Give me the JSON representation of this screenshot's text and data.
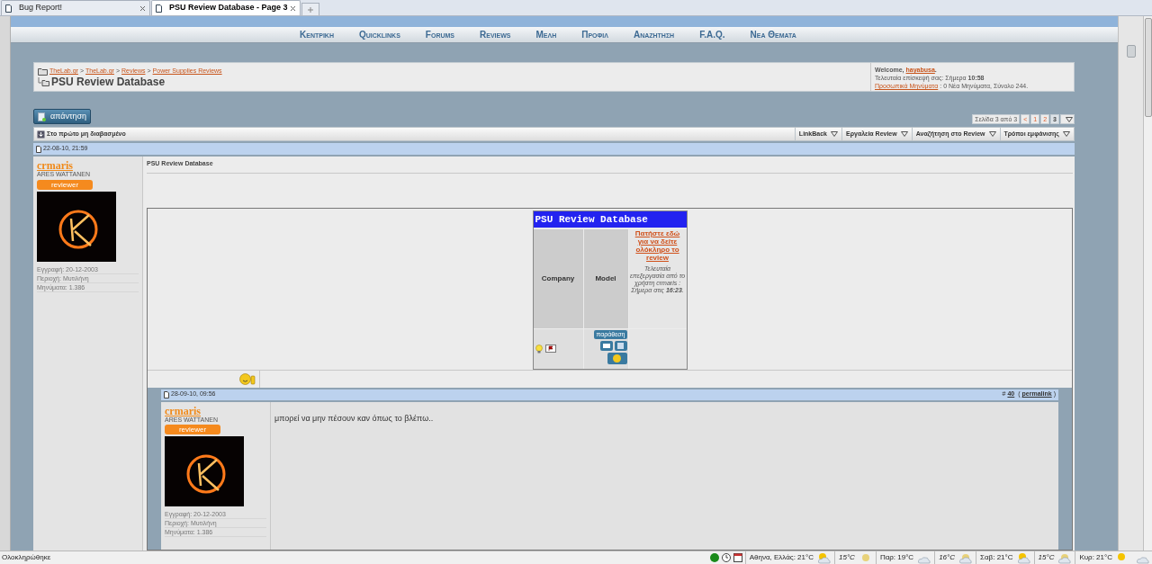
{
  "browser_tabs": [
    {
      "label": "Bug Report!",
      "selected": false
    },
    {
      "label": "PSU Review Database - Page 3",
      "selected": true
    }
  ],
  "nav": [
    "Κεντρικη",
    "Quicklinks",
    "Forums",
    "Reviews",
    "Μελη",
    "Προφιλ",
    "Αναζητηση",
    "F.A.Q.",
    "Νεα Θεματα"
  ],
  "breadcrumb": {
    "links": [
      "TheLab.gr",
      "TheLab.gr",
      "Reviews",
      "Power Supplies Reviews"
    ],
    "separator": ">",
    "title": "PSU Review Database"
  },
  "welcome": {
    "greeting": "Welcome,",
    "user": "hayabusa",
    "end": ".",
    "last_visit": "Τελευταία επίσκεψή σας: Σήμερα **10:58**",
    "pm_link": "Προσωπικά Μηνύματα",
    "pm_text": ": 0 Νέα Μηνύματα, Σύνολο 244."
  },
  "reply_button": "απάντηση",
  "pagination": {
    "label": "Σελίδα 3 από 3",
    "prev": "<",
    "pages": [
      {
        "label": "1",
        "selected": false
      },
      {
        "label": "2",
        "selected": false
      },
      {
        "label": "3",
        "selected": true
      }
    ]
  },
  "toolbar": {
    "first_unread": "Στο πρώτο μη διαβασμένο",
    "menus": [
      "LinkBack",
      "Εργαλεία Review",
      "Αναζήτηση στο Review",
      "Τρόποι εμφάνισης"
    ]
  },
  "posts": [
    {
      "date": "22-08-10, 21:59",
      "user": {
        "name": "crmaris",
        "title": "ARES WATTANEN",
        "rank": "reviewer",
        "stats": [
          "Εγγραφή: 20-12-2003",
          "Περιοχή: Μυτιλήνη",
          "Μηνύματα: 1.386"
        ]
      },
      "title": "PSU Review Database",
      "db_table": {
        "header": "PSU Review Database",
        "columns": [
          "Company",
          "Model"
        ],
        "link": "Πατήστε εδώ για να δείτε ολόκληρο το review",
        "edit_note": "Τελευταία επεξεργασία από το χρήστη crmaris : Σήμερα στις **16:23**.",
        "quote_button": "παράθεση"
      }
    },
    {
      "date": "28-09-10, 09:56",
      "number_prefix": "#",
      "number": "40",
      "permalink_open": "(",
      "permalink": "permalink",
      "permalink_close": ")",
      "user": {
        "name": "crmaris",
        "title": "ARES WATTANEN",
        "rank": "reviewer",
        "stats": [
          "Εγγραφή: 20-12-2003",
          "Περιοχή: Μυτιλήνη",
          "Μηνύματα: 1.386"
        ]
      },
      "message": "μπορεί να μην πέσουν καν όπως το βλέπω.."
    }
  ],
  "status_bar": {
    "text": "Ολοκληρώθηκε",
    "weather": [
      {
        "label": "Αθηνα, Ελλάς: 21°C",
        "kind": "sun_cloud"
      },
      {
        "label": "15°C",
        "kind": "moon"
      },
      {
        "label": "Παρ: 19°C",
        "kind": "cloud"
      },
      {
        "label": "16°C",
        "kind": "moon_cloud"
      },
      {
        "label": "Σαβ: 21°C",
        "kind": "sun_cloud"
      },
      {
        "label": "15°C",
        "kind": "moon_cloud"
      },
      {
        "label": "Κυρ: 21°C",
        "kind": "sun"
      }
    ]
  }
}
